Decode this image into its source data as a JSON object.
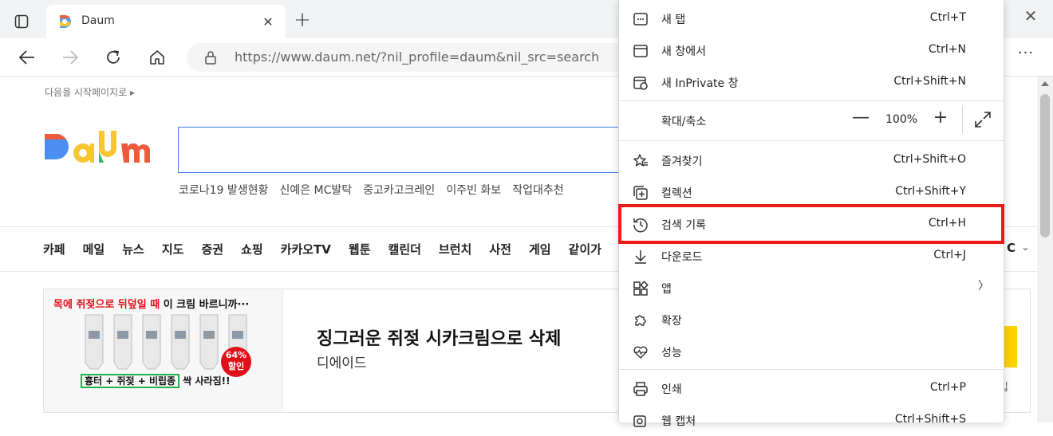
{
  "browser": {
    "tab": {
      "title": "Daum"
    },
    "toolbar": {
      "url": "https://www.daum.net/?nil_profile=daum&nil_src=search",
      "more_label": "···"
    }
  },
  "page": {
    "start_link": "다음을 시작페이지로 ▸",
    "trending": [
      "코로나19 발생현황",
      "신예은 MC발탁",
      "중고카고크레인",
      "이주빈 화보",
      "작업대추천"
    ],
    "nav": [
      "카페",
      "메일",
      "뉴스",
      "지도",
      "증권",
      "쇼핑",
      "카카오TV",
      "웹툰",
      "캘린더",
      "브런치",
      "사전",
      "게임",
      "같이가"
    ],
    "nav_more": "C",
    "ad": {
      "image_headline_red": "목에 쥐젖으로 뒤덮일 때",
      "image_headline_black": " 이 크림 바르니까···",
      "image_bottom_box": "흉터 + 쥐젖 + 비립종",
      "image_bottom_rest": " 싹 사라짐!!",
      "discount": "64%",
      "discount_sub": "할인",
      "title": "징그러운 쥐젖 시카크림으로 삭제",
      "advertiser": "디에이드",
      "side_text": "입"
    }
  },
  "menu": {
    "items": [
      {
        "label": "새 탭",
        "shortcut": "Ctrl+T",
        "icon": "new-tab-icon"
      },
      {
        "label": "새 창에서",
        "shortcut": "Ctrl+N",
        "icon": "new-window-icon"
      },
      {
        "label": "새 InPrivate 창",
        "shortcut": "Ctrl+Shift+N",
        "icon": "inprivate-icon"
      },
      {
        "label": "확대/축소",
        "icon": "none"
      },
      {
        "label": "즐겨찾기",
        "shortcut": "Ctrl+Shift+O",
        "icon": "favorites-icon"
      },
      {
        "label": "컬렉션",
        "shortcut": "Ctrl+Shift+Y",
        "icon": "collections-icon"
      },
      {
        "label": "검색 기록",
        "shortcut": "Ctrl+H",
        "icon": "history-icon"
      },
      {
        "label": "다운로드",
        "shortcut": "Ctrl+J",
        "icon": "download-icon"
      },
      {
        "label": "앱",
        "icon": "apps-icon"
      },
      {
        "label": "확장",
        "icon": "extensions-icon"
      },
      {
        "label": "성능",
        "icon": "performance-icon"
      },
      {
        "label": "인쇄",
        "shortcut": "Ctrl+P",
        "icon": "print-icon"
      },
      {
        "label": "웹 캡처",
        "shortcut": "Ctrl+Shift+S",
        "icon": "web-capture-icon"
      }
    ],
    "zoom": {
      "minus": "—",
      "value": "100%",
      "plus": "+"
    }
  },
  "colors": {
    "highlight": "#ee1a1a",
    "search_border": "#3f7be5",
    "ad_red": "#e0101b"
  }
}
